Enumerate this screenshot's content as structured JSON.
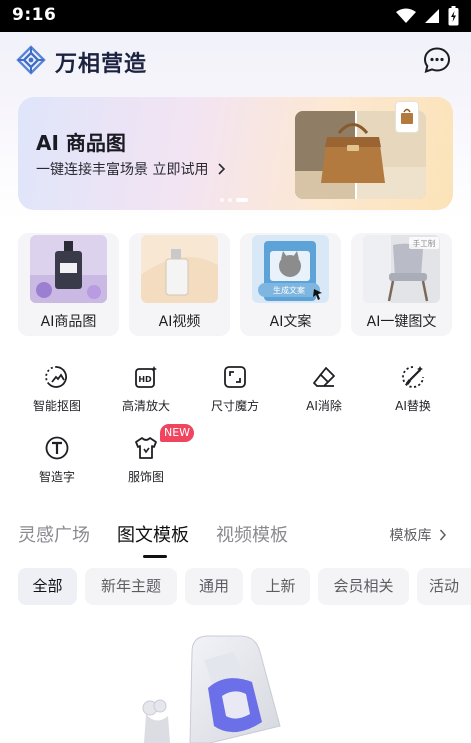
{
  "status_bar": {
    "time": "9:16"
  },
  "header": {
    "app_title": "万相营造"
  },
  "banner": {
    "title": "AI 商品图",
    "subtitle": "一键连接丰富场景 立即试用"
  },
  "features": [
    {
      "label": "AI商品图"
    },
    {
      "label": "AI视频"
    },
    {
      "label": "AI文案",
      "art_caption": "生成文案"
    },
    {
      "label": "AI一键图文",
      "art_caption": "手工制"
    }
  ],
  "tools": [
    {
      "label": "智能抠图",
      "icon": "smart-cutout-icon"
    },
    {
      "label": "高清放大",
      "icon": "hd-upscale-icon"
    },
    {
      "label": "尺寸魔方",
      "icon": "resize-icon"
    },
    {
      "label": "AI消除",
      "icon": "eraser-icon"
    },
    {
      "label": "AI替换",
      "icon": "magic-wand-icon"
    },
    {
      "label": "智造字",
      "icon": "text-icon"
    },
    {
      "label": "服饰图",
      "icon": "tshirt-icon",
      "badge": "NEW"
    }
  ],
  "tabs": [
    {
      "label": "灵感广场",
      "active": false
    },
    {
      "label": "图文模板",
      "active": true
    },
    {
      "label": "视频模板",
      "active": false
    }
  ],
  "library_link": "模板库",
  "filter_chips": [
    {
      "label": "全部",
      "active": true
    },
    {
      "label": "新年主题",
      "active": false
    },
    {
      "label": "通用",
      "active": false
    },
    {
      "label": "上新",
      "active": false
    },
    {
      "label": "会员相关",
      "active": false
    },
    {
      "label": "活动",
      "active": false
    }
  ],
  "colors": {
    "badge_red": "#f0455f",
    "brand_navy": "#1c2340",
    "logo_blue": "#5a86d8"
  }
}
